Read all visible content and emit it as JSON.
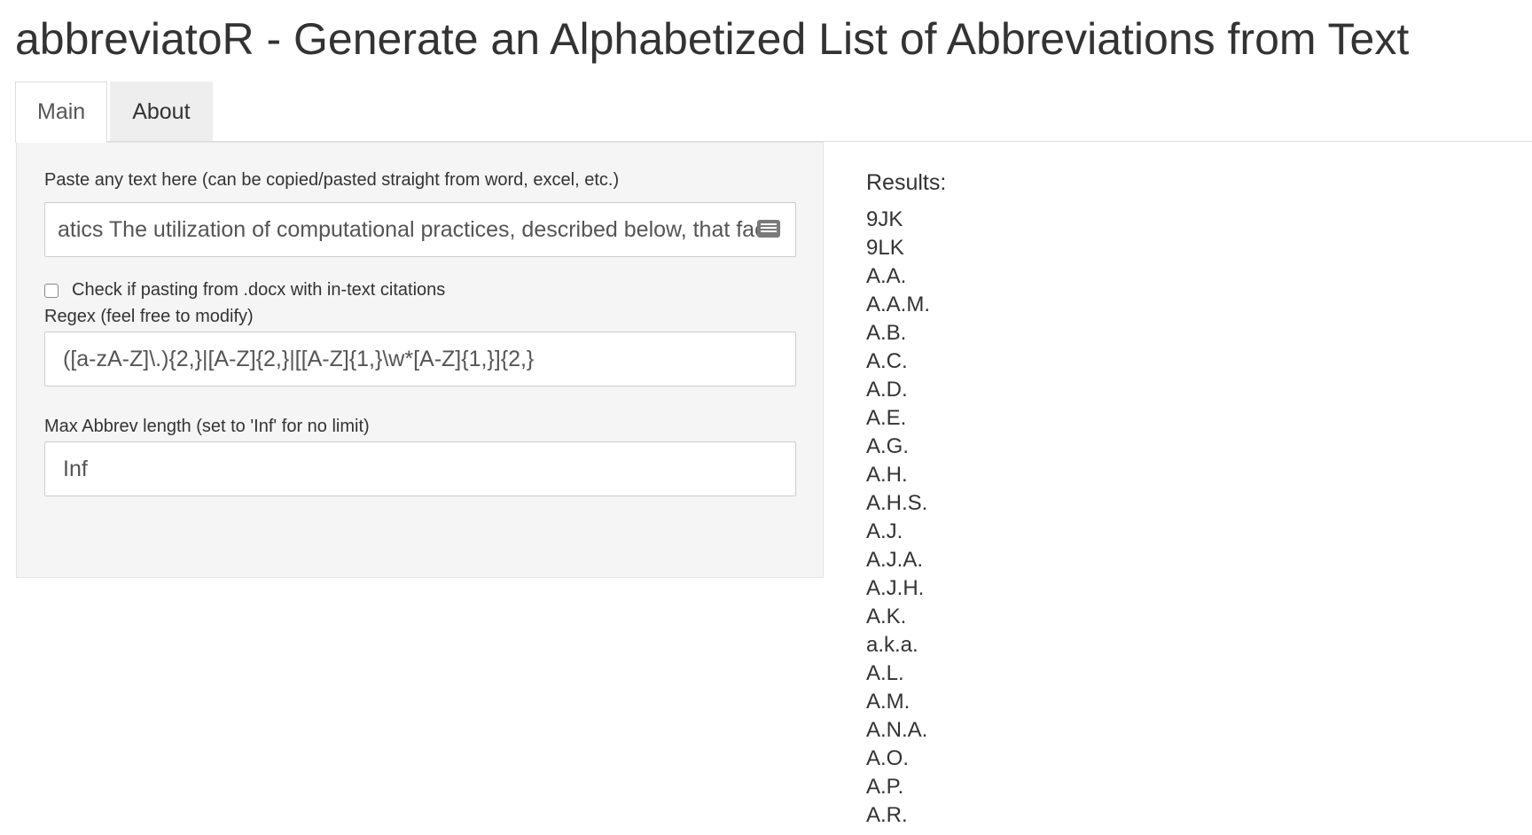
{
  "app": {
    "title": "abbreviatoR - Generate an Alphabetized List of Abbreviations from Text"
  },
  "tabs": [
    {
      "label": "Main",
      "active": true
    },
    {
      "label": "About",
      "active": false
    }
  ],
  "sidebar": {
    "text_label": "Paste any text here (can be copied/pasted straight from word, excel, etc.)",
    "text_value": "atics The utilization of computational practices, described below, that faci",
    "checkbox_label": "Check if pasting from .docx with in-text citations",
    "checkbox_checked": false,
    "regex_label": "Regex (feel free to modify)",
    "regex_value": "([a-zA-Z]\\.){2,}|[A-Z]{2,}|[[A-Z]{1,}\\w*[A-Z]{1,}]{2,}",
    "maxlen_label": "Max Abbrev length (set to 'Inf' for no limit)",
    "maxlen_value": "Inf"
  },
  "results": {
    "label": "Results:",
    "items": [
      "9JK",
      "9LK",
      "A.A.",
      "A.A.M.",
      "A.B.",
      "A.C.",
      "A.D.",
      "A.E.",
      "A.G.",
      "A.H.",
      "A.H.S.",
      "A.J.",
      "A.J.A.",
      "A.J.H.",
      "A.K.",
      "a.k.a.",
      "A.L.",
      "A.M.",
      "A.N.A.",
      "A.O.",
      "A.P.",
      "A.R."
    ]
  },
  "colors": {
    "sidebar_bg": "#f5f5f5",
    "tab_inactive_bg": "#eeeeee",
    "border": "#dddddd"
  },
  "icons": {
    "text_field_icon": "keyboard-icon"
  }
}
